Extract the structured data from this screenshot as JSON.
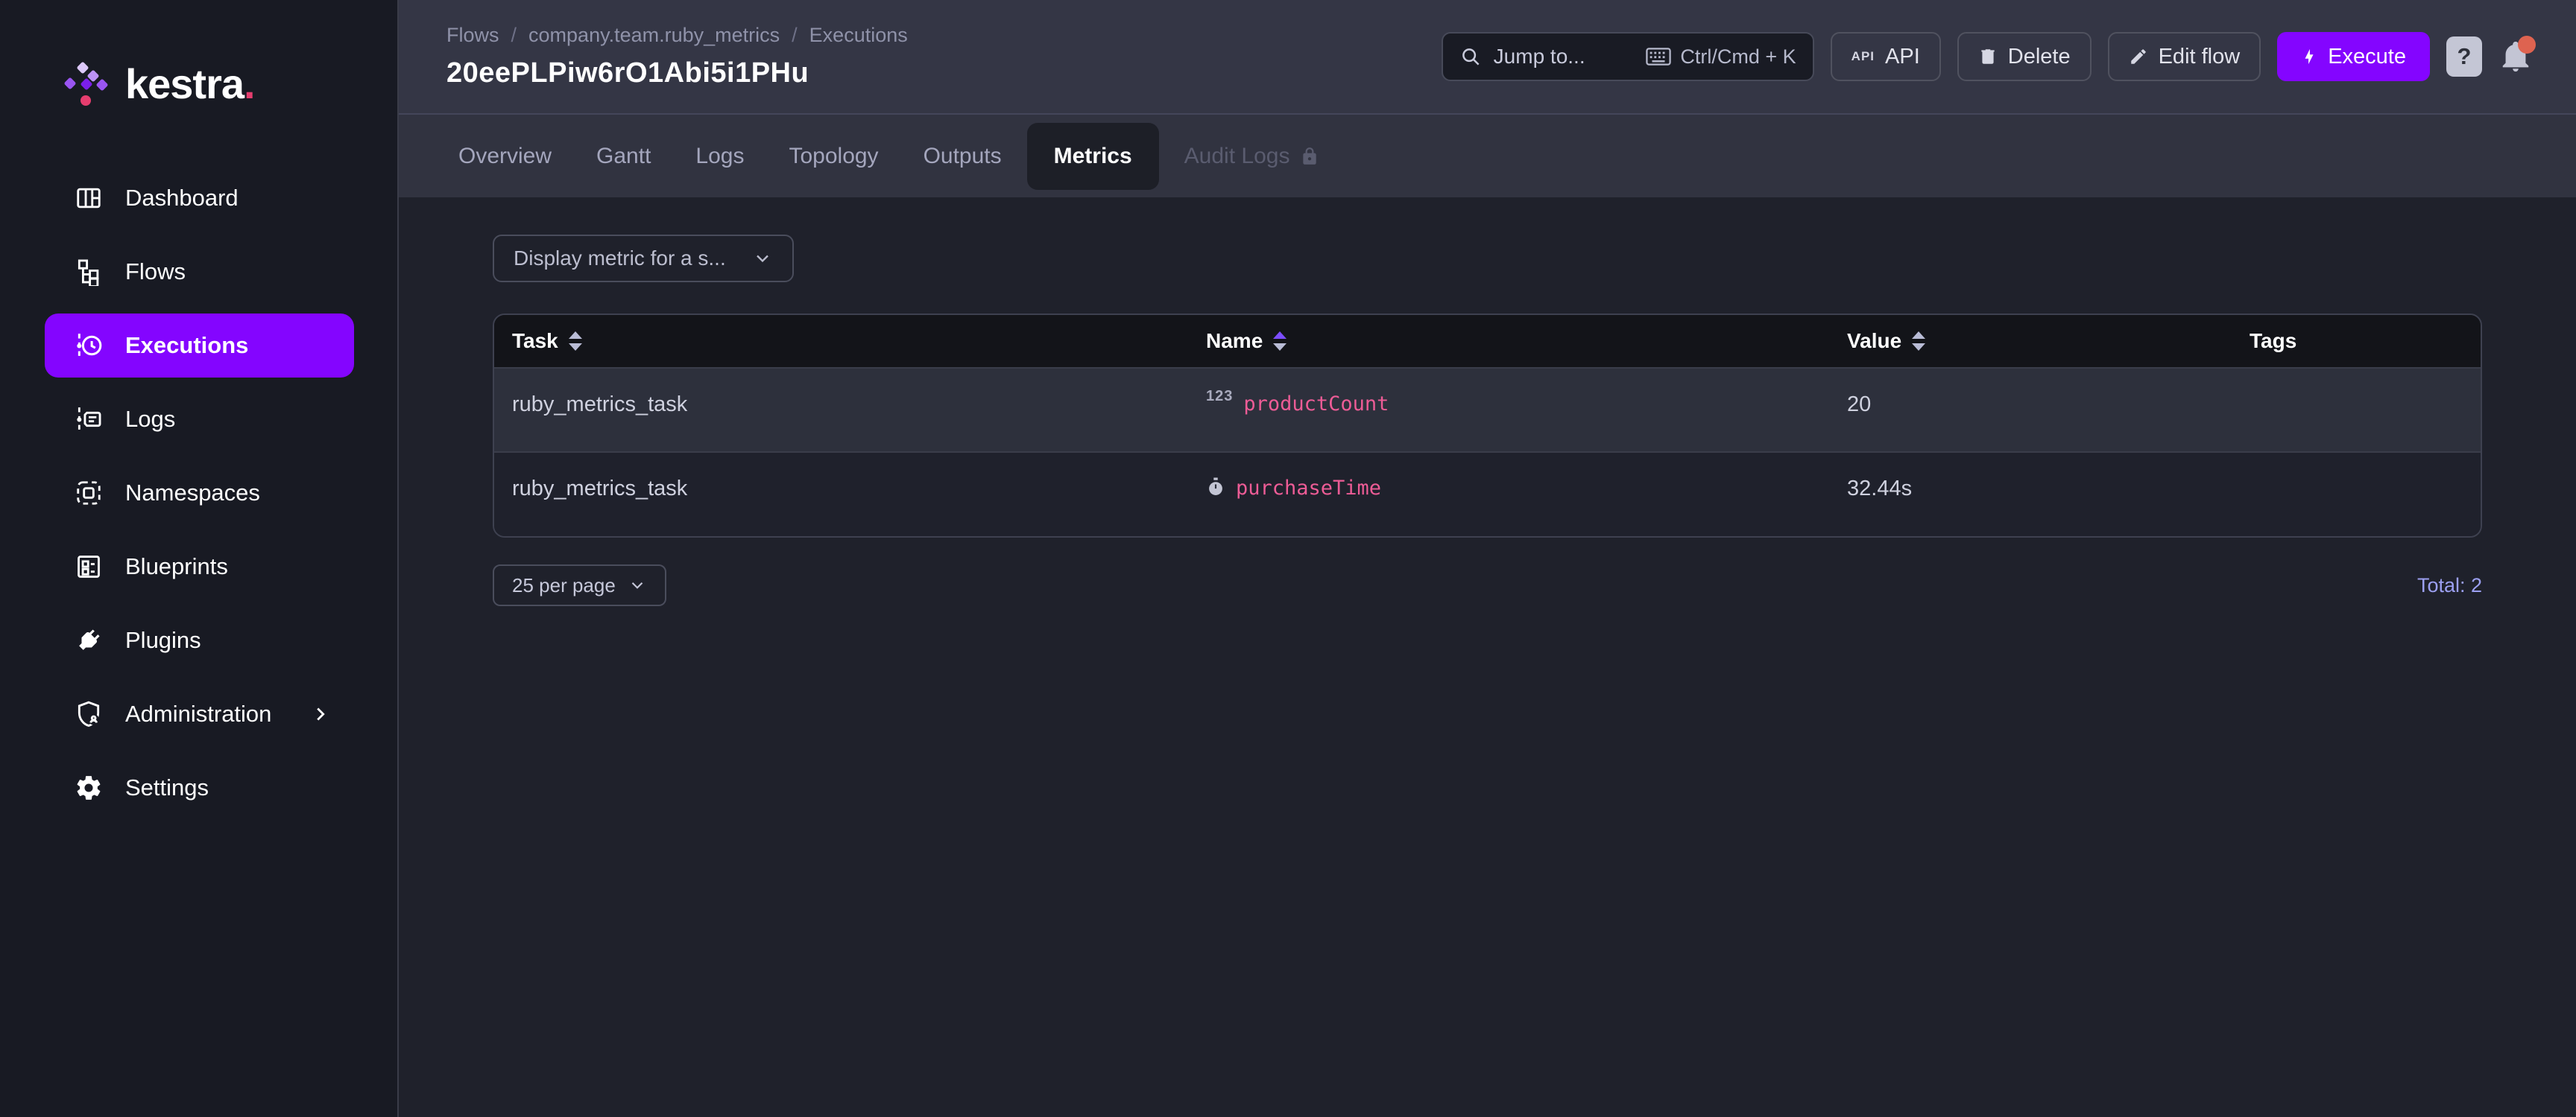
{
  "colors": {
    "accent_purple": "#8405FF",
    "logo_pink": "#E53D6E",
    "metric_pink": "#ED5C96",
    "total_purple": "#9CA0F2",
    "notification_red": "#DE6350",
    "sort_active_purple": "#7C4DFF"
  },
  "brand": {
    "wordmark": "kestra",
    "wordmark_dot": "."
  },
  "sidebar": {
    "items": [
      {
        "label": "Dashboard"
      },
      {
        "label": "Flows"
      },
      {
        "label": "Executions",
        "active": true
      },
      {
        "label": "Logs"
      },
      {
        "label": "Namespaces"
      },
      {
        "label": "Blueprints"
      },
      {
        "label": "Plugins"
      },
      {
        "label": "Administration",
        "has_submenu": true
      },
      {
        "label": "Settings"
      }
    ]
  },
  "header": {
    "breadcrumb": {
      "parts": [
        "Flows",
        "company.team.ruby_metrics",
        "Executions"
      ],
      "separator": "/"
    },
    "title": "20eePLPiw6rO1Abi5i1PHu",
    "search": {
      "placeholder": "Jump to...",
      "shortcut": "Ctrl/Cmd + K"
    },
    "actions": {
      "api_badge": "API",
      "api": "API",
      "delete": "Delete",
      "edit_flow": "Edit flow",
      "execute": "Execute",
      "help": "?"
    }
  },
  "tabs": [
    {
      "label": "Overview"
    },
    {
      "label": "Gantt"
    },
    {
      "label": "Logs"
    },
    {
      "label": "Topology"
    },
    {
      "label": "Outputs"
    },
    {
      "label": "Metrics",
      "active": true
    },
    {
      "label": "Audit Logs",
      "locked": true
    }
  ],
  "metrics_view": {
    "metric_filter_placeholder": "Display metric for a s...",
    "table": {
      "columns": [
        {
          "label": "Task",
          "sortable": true
        },
        {
          "label": "Name",
          "sortable": true,
          "sorted": "asc"
        },
        {
          "label": "Value",
          "sortable": true
        },
        {
          "label": "Tags",
          "sortable": false
        }
      ],
      "rows": [
        {
          "task": "ruby_metrics_task",
          "metric_type": "counter",
          "metric_icon": "123-counter-icon",
          "name": "productCount",
          "value": "20",
          "tags": ""
        },
        {
          "task": "ruby_metrics_task",
          "metric_type": "timer",
          "metric_icon": "stopwatch-icon",
          "name": "purchaseTime",
          "value": "32.44s",
          "tags": ""
        }
      ]
    },
    "pagination": {
      "per_page": "25 per page",
      "total": "Total: 2"
    }
  }
}
